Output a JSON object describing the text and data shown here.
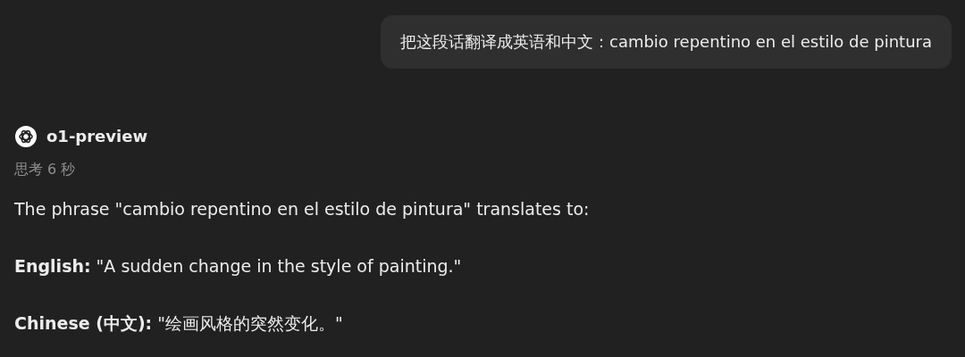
{
  "user_message": {
    "text": "把这段话翻译成英语和中文：cambio repentino en el estilo de pintura"
  },
  "assistant": {
    "model": "o1-preview",
    "thinking": "思考 6 秒",
    "paragraphs": [
      "The phrase \"cambio repentino en el estilo de pintura\" translates to:",
      "**English:** \"A sudden change in the style of painting.\"",
      "**Chinese (中文):** \"绘画风格的突然变化。\""
    ]
  }
}
